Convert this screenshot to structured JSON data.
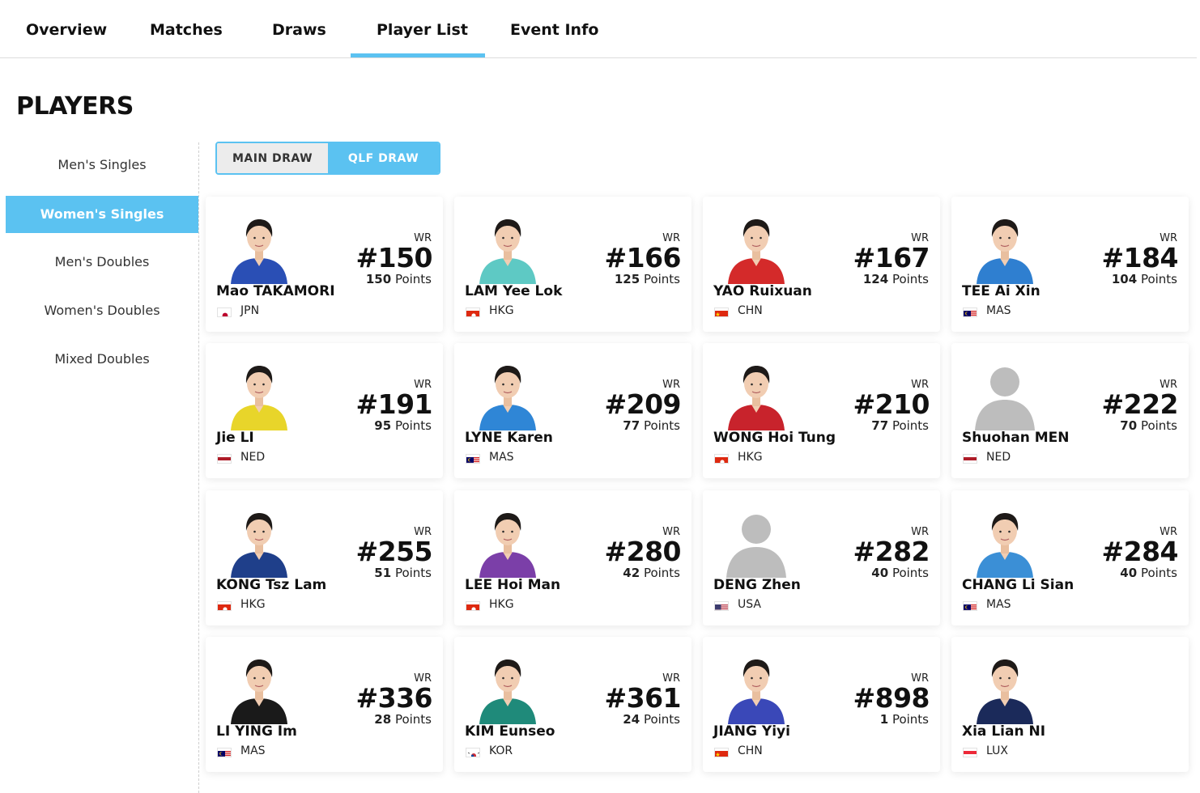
{
  "nav": {
    "tabs": [
      {
        "label": "Overview"
      },
      {
        "label": "Matches"
      },
      {
        "label": "Draws"
      },
      {
        "label": "Player List",
        "active": true
      },
      {
        "label": "Event Info"
      }
    ]
  },
  "page_title": "PLAYERS",
  "sidebar": {
    "items": [
      {
        "label": "Men's Singles"
      },
      {
        "label": "Women's Singles",
        "active": true
      },
      {
        "label": "Men's Doubles"
      },
      {
        "label": "Women's Doubles"
      },
      {
        "label": "Mixed Doubles"
      }
    ]
  },
  "draw_toggle": {
    "main": "MAIN DRAW",
    "qlf": "QLF DRAW",
    "selected": "QLF DRAW"
  },
  "accent_color": "#5bc2f1",
  "players": [
    {
      "name": "Mao TAKAMORI",
      "country": "JPN",
      "wr_label": "WR",
      "rank": "#150",
      "points": "150",
      "points_label": "Points",
      "shirt": "#2a4fb5",
      "photo": true
    },
    {
      "name": "LAM Yee Lok",
      "country": "HKG",
      "wr_label": "WR",
      "rank": "#166",
      "points": "125",
      "points_label": "Points",
      "shirt": "#5ec9c4",
      "photo": true
    },
    {
      "name": "YAO Ruixuan",
      "country": "CHN",
      "wr_label": "WR",
      "rank": "#167",
      "points": "124",
      "points_label": "Points",
      "shirt": "#d42a2a",
      "photo": true
    },
    {
      "name": "TEE Ai Xin",
      "country": "MAS",
      "wr_label": "WR",
      "rank": "#184",
      "points": "104",
      "points_label": "Points",
      "shirt": "#2f7fd0",
      "photo": true
    },
    {
      "name": "Jie LI",
      "country": "NED",
      "wr_label": "WR",
      "rank": "#191",
      "points": "95",
      "points_label": "Points",
      "shirt": "#e8d52a",
      "photo": true
    },
    {
      "name": "LYNE Karen",
      "country": "MAS",
      "wr_label": "WR",
      "rank": "#209",
      "points": "77",
      "points_label": "Points",
      "shirt": "#2f86d6",
      "photo": true
    },
    {
      "name": "WONG Hoi Tung",
      "country": "HKG",
      "wr_label": "WR",
      "rank": "#210",
      "points": "77",
      "points_label": "Points",
      "shirt": "#c8232c",
      "photo": true
    },
    {
      "name": "Shuohan MEN",
      "country": "NED",
      "wr_label": "WR",
      "rank": "#222",
      "points": "70",
      "points_label": "Points",
      "shirt": "#c4c4c4",
      "photo": false
    },
    {
      "name": "KONG Tsz Lam",
      "country": "HKG",
      "wr_label": "WR",
      "rank": "#255",
      "points": "51",
      "points_label": "Points",
      "shirt": "#1f3f8a",
      "photo": true
    },
    {
      "name": "LEE Hoi Man",
      "country": "HKG",
      "wr_label": "WR",
      "rank": "#280",
      "points": "42",
      "points_label": "Points",
      "shirt": "#7b3fa8",
      "photo": true
    },
    {
      "name": "DENG Zhen",
      "country": "USA",
      "wr_label": "WR",
      "rank": "#282",
      "points": "40",
      "points_label": "Points",
      "shirt": "#c4c4c4",
      "photo": false
    },
    {
      "name": "CHANG Li Sian",
      "country": "MAS",
      "wr_label": "WR",
      "rank": "#284",
      "points": "40",
      "points_label": "Points",
      "shirt": "#3b8fd6",
      "photo": true
    },
    {
      "name": "LI YING Im",
      "country": "MAS",
      "wr_label": "WR",
      "rank": "#336",
      "points": "28",
      "points_label": "Points",
      "shirt": "#1a1a1a",
      "photo": true
    },
    {
      "name": "KIM Eunseo",
      "country": "KOR",
      "wr_label": "WR",
      "rank": "#361",
      "points": "24",
      "points_label": "Points",
      "shirt": "#1f8a7a",
      "photo": true
    },
    {
      "name": "JIANG Yiyi",
      "country": "CHN",
      "wr_label": "WR",
      "rank": "#898",
      "points": "1",
      "points_label": "Points",
      "shirt": "#3a48b8",
      "photo": true
    },
    {
      "name": "Xia Lian NI",
      "country": "LUX",
      "wr_label": "",
      "rank": "",
      "points": "",
      "points_label": "",
      "shirt": "#1b2a5a",
      "photo": true
    }
  ]
}
